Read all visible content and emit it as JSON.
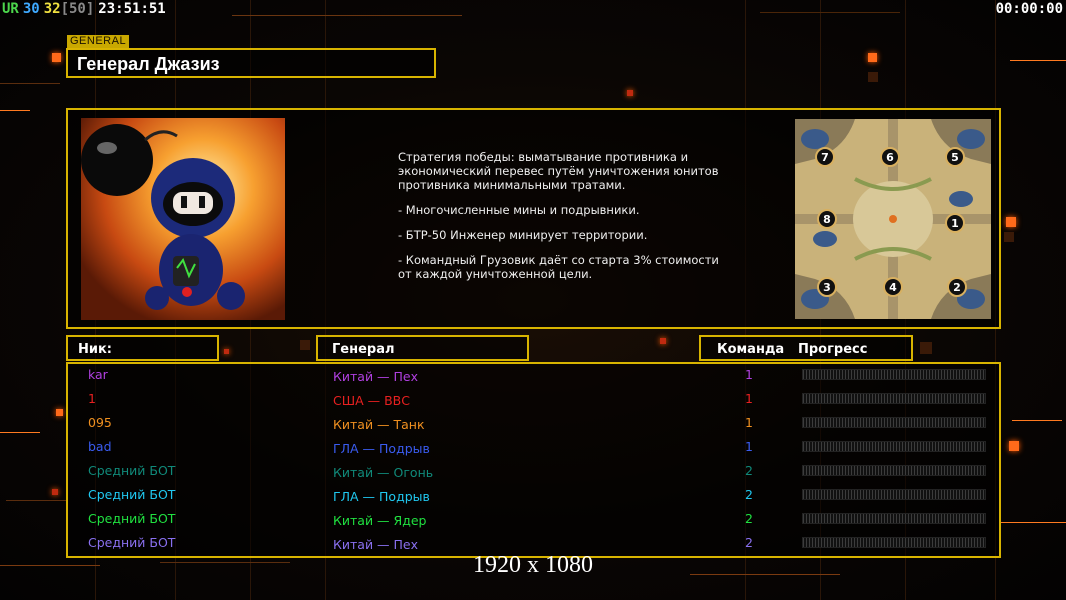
{
  "hud": {
    "left_parts": [
      {
        "text": "UR",
        "color": "#4cd64c"
      },
      {
        "text": "30",
        "color": "#3fa9ff"
      },
      {
        "text": "32",
        "color": "#f0e040"
      },
      {
        "text": "[50]",
        "color": "#8a8a8a"
      },
      {
        "text": "23:51:51",
        "color": "#ffffff"
      }
    ],
    "right_time": "00:00:00"
  },
  "section_label": "GENERAL",
  "general_name": "Генерал Джазиз",
  "description": [
    "Стратегия победы: выматывание противника и экономический перевес путём уничтожения юнитов противника минимальными тратами.",
    "- Многочисленные мины и подрывники.",
    "- БТР-50 Инженер минирует территории.",
    "- Командный Грузовик даёт со старта 3% стоимости от каждой уничтоженной цели."
  ],
  "map_slots": [
    "7",
    "6",
    "5",
    "8",
    "1",
    "3",
    "4",
    "2"
  ],
  "headers": {
    "nick": "Ник:",
    "general": "Генерал",
    "team": "Команда",
    "progress": "Прогресс"
  },
  "players": [
    {
      "nick": "kar",
      "general": "Китай — Пех",
      "team": "1",
      "color": "#b040e0",
      "progress": 0
    },
    {
      "nick": "1",
      "general": "США — ВВС",
      "team": "1",
      "color": "#e82020",
      "progress": 0
    },
    {
      "nick": "095",
      "general": "Китай — Танк",
      "team": "1",
      "color": "#f09020",
      "progress": 0
    },
    {
      "nick": "bad",
      "general": "ГЛА — Подрыв",
      "team": "1",
      "color": "#3a5cf0",
      "progress": 0
    },
    {
      "nick": "Средний БОТ",
      "general": "Китай — Огонь",
      "team": "2",
      "color": "#108a7a",
      "progress": 0
    },
    {
      "nick": "Средний БОТ",
      "general": "ГЛА — Подрыв",
      "team": "2",
      "color": "#20c8f0",
      "progress": 0
    },
    {
      "nick": "Средний БОТ",
      "general": "Китай — Ядер",
      "team": "2",
      "color": "#20e040",
      "progress": 0
    },
    {
      "nick": "Средний БОТ",
      "general": "Китай — Пех",
      "team": "2",
      "color": "#8a70f0",
      "progress": 0
    }
  ],
  "resolution_text": "1920 x 1080",
  "colors": {
    "frame": "#d8b400",
    "accent_orange": "#ff6a1a"
  }
}
